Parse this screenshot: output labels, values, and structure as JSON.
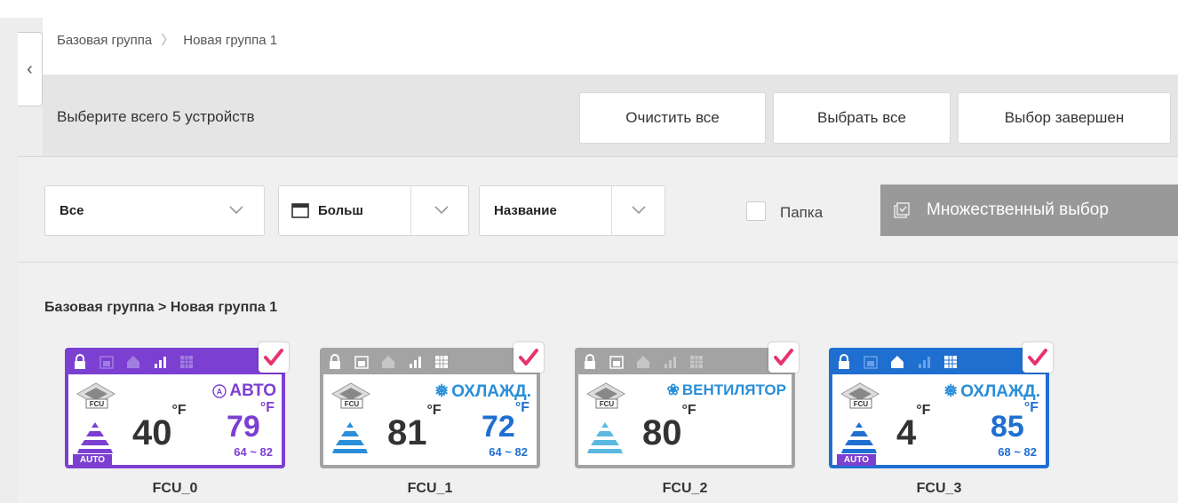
{
  "breadcrumb": {
    "root": "Базовая группа",
    "current": "Новая группа 1"
  },
  "selection": {
    "info": "Выберите всего 5 устройств",
    "clear_all": "Очистить все",
    "select_all": "Выбрать все",
    "done": "Выбор завершен"
  },
  "filters": {
    "type_value": "Все",
    "view_value": "Больш",
    "sort_value": "Название",
    "folder_label": "Папка",
    "multi_select": "Множественный выбор"
  },
  "group_path": "Базовая группа > Новая группа 1",
  "colors": {
    "purple": "#7b3fd1",
    "blue": "#1f6fd1",
    "gray": "#a3a3a3",
    "check": "#e8336a",
    "cool_blue": "#2a8ed8"
  },
  "devices": [
    {
      "name": "FCU_0",
      "current_temp": "40",
      "unit": "°F",
      "mode": "АВТО",
      "set_temp": "79",
      "range": "64 ~ 82",
      "auto_badge": "AUTO",
      "icon": "fcu-cassette-icon"
    },
    {
      "name": "FCU_1",
      "current_temp": "81",
      "unit": "°F",
      "mode": "ОХЛАЖД.",
      "set_temp": "72",
      "range": "64 ~ 82",
      "icon": "fcu-cassette-icon"
    },
    {
      "name": "FCU_2",
      "current_temp": "80",
      "unit": "°F",
      "mode": "ВЕНТИЛЯТОР",
      "icon": "fcu-cassette-icon"
    },
    {
      "name": "FCU_3",
      "current_temp": "4",
      "unit": "°F",
      "mode": "ОХЛАЖД.",
      "set_temp": "85",
      "range": "68 ~ 82",
      "auto_badge": "AUTO",
      "icon": "fcu-cassette-icon"
    }
  ]
}
